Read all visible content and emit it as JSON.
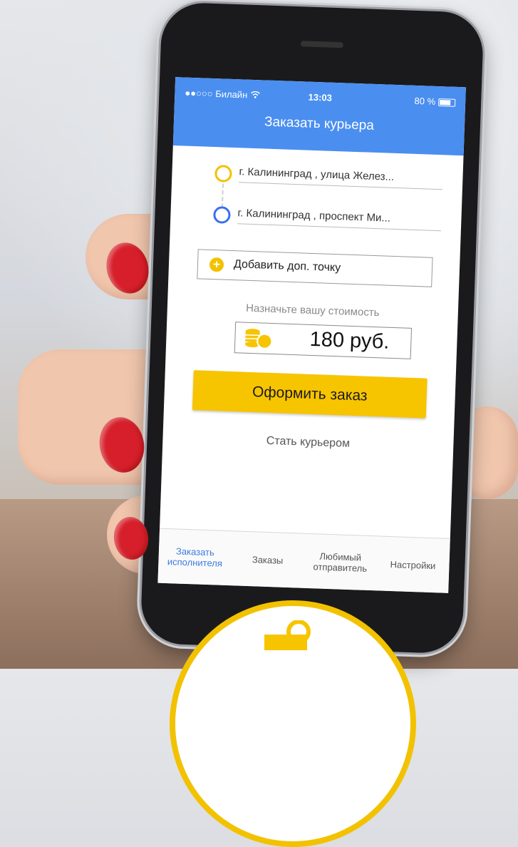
{
  "status_bar": {
    "carrier": "●●○○○ Билайн",
    "time": "13:03",
    "battery": "80 %"
  },
  "app_bar": {
    "title": "Заказать курьера"
  },
  "route": {
    "from": "г. Калининград , улица Желез...",
    "to": "г. Калининград , проспект Ми..."
  },
  "add_point": {
    "label": "Добавить доп. точку"
  },
  "price": {
    "caption": "Назначьте вашу стоимость",
    "value": "180 руб."
  },
  "order_button": {
    "label": "Оформить заказ"
  },
  "become_courier": {
    "label": "Стать курьером"
  },
  "tabs": [
    {
      "line1": "Заказать",
      "line2": "исполнителя",
      "active": true
    },
    {
      "line1": "Заказы",
      "line2": ""
    },
    {
      "line1": "Любимый",
      "line2": "отправитель"
    },
    {
      "line1": "Настройки",
      "line2": ""
    }
  ],
  "colors": {
    "app_bar": "#4a8ef0",
    "accent_yellow": "#f7c400",
    "pin_to": "#3a6ff0",
    "tab_active": "#3a7be0",
    "nails": "#d61f2a"
  },
  "icons": [
    "wifi-icon",
    "battery-icon",
    "plus-icon",
    "coins-icon"
  ]
}
